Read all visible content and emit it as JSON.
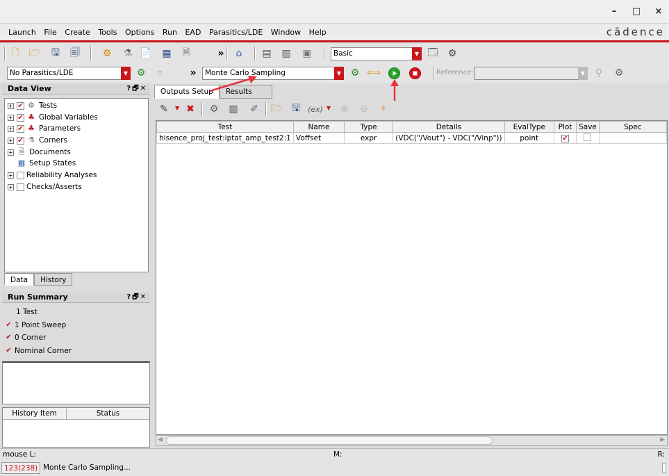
{
  "window": {
    "minimize": "–",
    "maximize": "□",
    "close": "×"
  },
  "menu": [
    "Launch",
    "File",
    "Create",
    "Tools",
    "Options",
    "Run",
    "EAD",
    "Parasitics/LDE",
    "Window",
    "Help"
  ],
  "brand": "cādence",
  "toolbar1": {
    "mode_combo": "Basic"
  },
  "toolbar2": {
    "parasitics_combo": "No Parasitics/LDE",
    "run_mode_combo": "Monte Carlo Sampling",
    "reference_label": "Reference:",
    "reference_value": ""
  },
  "data_view": {
    "title": "Data View",
    "header_buttons": "?🗗✕",
    "items": [
      {
        "label": "Tests",
        "checked": true,
        "expand": "+"
      },
      {
        "label": "Global Variables",
        "checked": true,
        "expand": "+"
      },
      {
        "label": "Parameters",
        "checked": true,
        "expand": "+"
      },
      {
        "label": "Corners",
        "checked": true,
        "expand": "+"
      },
      {
        "label": "Documents",
        "checked": false,
        "expand": "+"
      },
      {
        "label": "Setup States",
        "checked": false,
        "expand": ""
      },
      {
        "label": "Reliability Analyses",
        "checked": false,
        "expand": "+"
      },
      {
        "label": "Checks/Asserts",
        "checked": false,
        "expand": "+"
      }
    ],
    "tabs": [
      "Data",
      "History"
    ]
  },
  "run_summary": {
    "title": "Run Summary",
    "lines": [
      {
        "label": "1 Test",
        "checked": null
      },
      {
        "label": "1 Point Sweep",
        "checked": true
      },
      {
        "label": "0 Corner",
        "checked": true
      },
      {
        "label": "Nominal Corner",
        "checked": true
      }
    ],
    "history_columns": [
      "History Item",
      "Status"
    ]
  },
  "main_tabs": [
    "Outputs Setup",
    "Results"
  ],
  "outputs_table": {
    "columns": [
      "Test",
      "Name",
      "Type",
      "Details",
      "EvalType",
      "Plot",
      "Save",
      "Spec"
    ],
    "rows": [
      {
        "test": "hisence_proj_test:iptat_amp_test2:1",
        "name": "Voffset",
        "type": "expr",
        "details": "(VDC(\"/Vout\") - VDC(\"/Vinp\"))",
        "evaltype": "point",
        "plot": true,
        "save": false,
        "spec": ""
      }
    ]
  },
  "status": {
    "mouse_l": "mouse L:",
    "mouse_m": "M:",
    "mouse_r": "R:",
    "counter": "123(238)",
    "message": "Monte Carlo Sampling..."
  },
  "colors": {
    "accent": "#c8161b",
    "run_green": "#2aa52a",
    "stop_red": "#d8121a",
    "annotation_arrow": "#e8323c"
  }
}
